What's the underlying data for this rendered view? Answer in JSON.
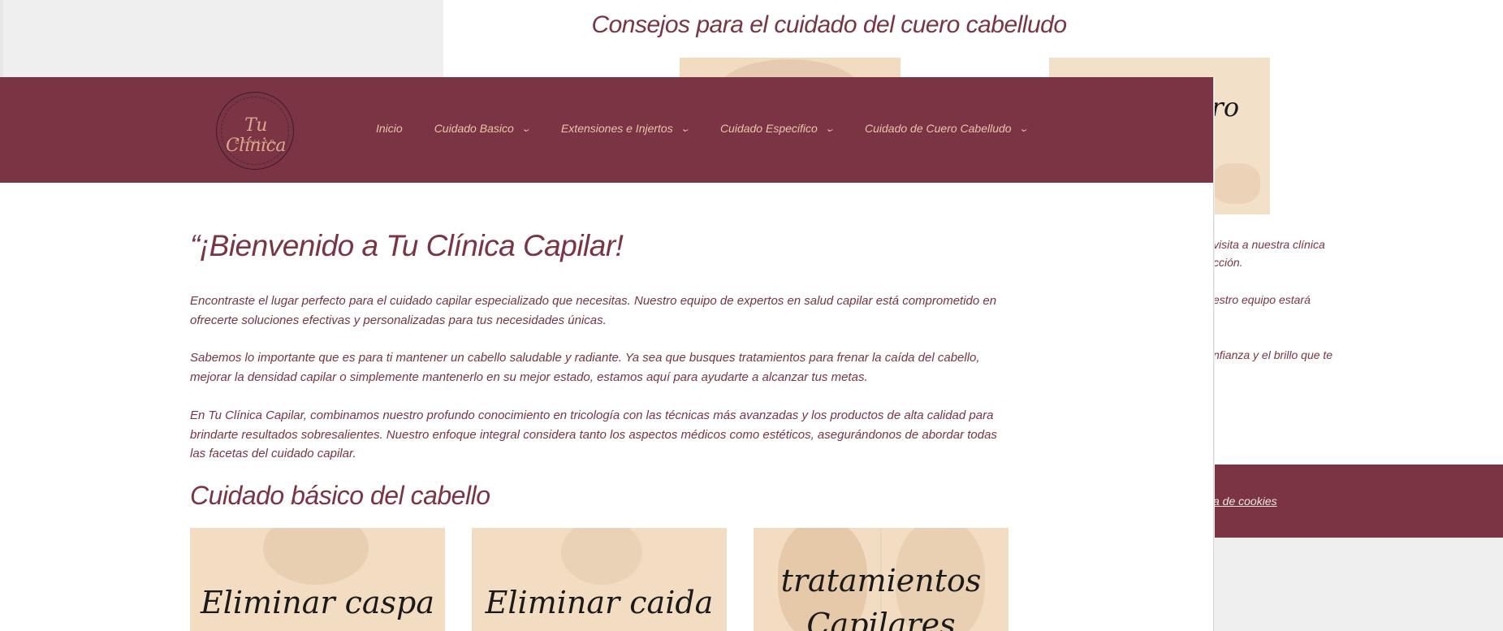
{
  "background": {
    "title": "Consejos para el cuidado del cuero cabelludo",
    "card_word": "uero",
    "text_lines": [
      "visita a nuestra clínica",
      "cción.",
      "estro equipo estará",
      "nfianza y el brillo que te"
    ],
    "footer_link": "a de cookies"
  },
  "nav": {
    "logo_name": "Tu Clínica",
    "logo_sub": "CAPILAR",
    "items": [
      {
        "label": "Inicio",
        "has_dropdown": false
      },
      {
        "label": "Cuidado Basico",
        "has_dropdown": true
      },
      {
        "label": "Extensiones e Injertos",
        "has_dropdown": true
      },
      {
        "label": "Cuidado Especifico",
        "has_dropdown": true
      },
      {
        "label": "Cuidado de Cuero Cabelludo",
        "has_dropdown": true
      }
    ]
  },
  "main": {
    "heading": "“¡Bienvenido a Tu Clínica Capilar!",
    "paragraphs": [
      "Encontraste el lugar perfecto para el cuidado capilar especializado que necesitas. Nuestro equipo de expertos en salud capilar está comprometido en ofrecerte soluciones efectivas y personalizadas para tus necesidades únicas.",
      "Sabemos lo importante que es para ti mantener un cabello saludable y radiante. Ya sea que busques tratamientos para frenar la caída del cabello, mejorar la densidad capilar o simplemente mantenerlo en su mejor estado, estamos aquí para ayudarte a alcanzar tus metas.",
      "En Tu Clínica Capilar, combinamos nuestro profundo conocimiento en tricología con las técnicas más avanzadas y los productos de alta calidad para brindarte resultados sobresalientes. Nuestro enfoque integral considera tanto los aspectos médicos como estéticos, asegurándonos de abordar todas las facetas del cuidado capilar."
    ],
    "section_title": "Cuidado básico del cabello",
    "cards": [
      {
        "title": "Eliminar caspa"
      },
      {
        "title": "Eliminar caida"
      },
      {
        "title": "tratamientos Capilares"
      }
    ]
  },
  "colors": {
    "brand": "#7a3443",
    "menu_text": "#e8c6a8",
    "card_bg": "#f2ddc3"
  }
}
